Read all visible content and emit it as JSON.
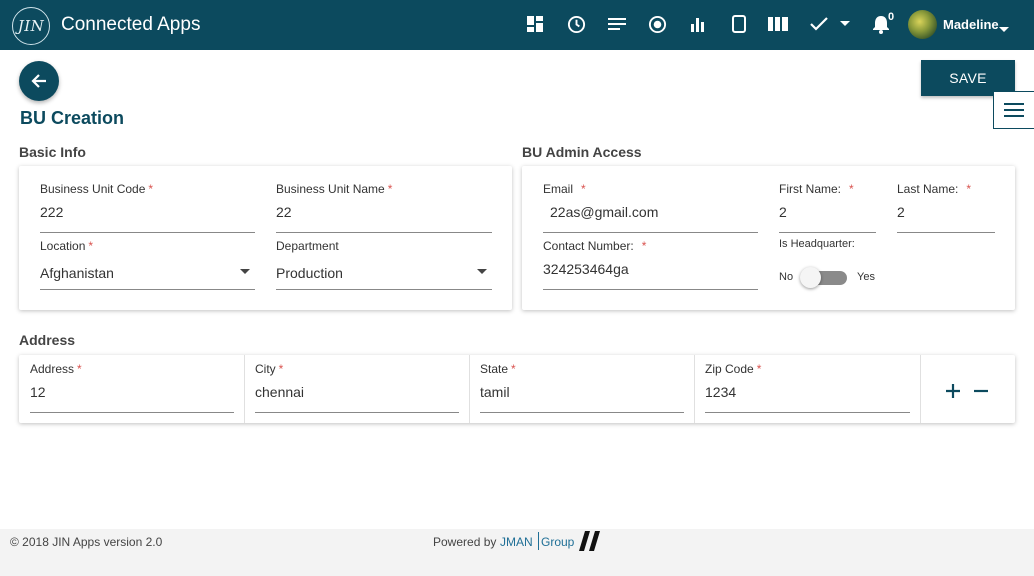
{
  "header": {
    "logo_text": "JIN",
    "app_title": "Connected Apps",
    "notification_count": "0",
    "username": "Madeline",
    "icons": [
      "dashboard-icon",
      "clock-icon",
      "list-icon",
      "target-icon",
      "bar-chart-icon",
      "tablet-icon",
      "columns-icon",
      "check-icon",
      "bell-icon"
    ]
  },
  "page": {
    "title": "BU Creation",
    "save_label": "SAVE"
  },
  "basic_info": {
    "title": "Basic Info",
    "business_unit_code": {
      "label": "Business Unit Code",
      "value": "222"
    },
    "business_unit_name": {
      "label": "Business Unit Name",
      "value": "22"
    },
    "location": {
      "label": "Location",
      "value": "Afghanistan"
    },
    "department": {
      "label": "Department",
      "value": "Production"
    }
  },
  "admin_access": {
    "title": "BU Admin Access",
    "email": {
      "label": "Email",
      "value": "22as@gmail.com"
    },
    "first_name": {
      "label": "First Name:",
      "value": "2"
    },
    "last_name": {
      "label": "Last Name:",
      "value": "2"
    },
    "contact_number": {
      "label": "Contact Number:",
      "value": "324253464ga"
    },
    "is_headquarter": {
      "label": "Is Headquarter:",
      "no_label": "No",
      "yes_label": "Yes",
      "state": "off"
    }
  },
  "address": {
    "title": "Address",
    "address": {
      "label": "Address",
      "value": "12"
    },
    "city": {
      "label": "City",
      "value": "chennai"
    },
    "state": {
      "label": "State",
      "value": "tamil"
    },
    "zip": {
      "label": "Zip Code",
      "value": "1234"
    }
  },
  "footer": {
    "copyright": "© 2018 JIN Apps version 2.0",
    "powered_by": "Powered by",
    "brand_primary": "JMAN",
    "brand_secondary": "Group"
  },
  "colors": {
    "primary": "#0c4a5e",
    "required": "#d9534f",
    "brand": "#1f6f96"
  }
}
